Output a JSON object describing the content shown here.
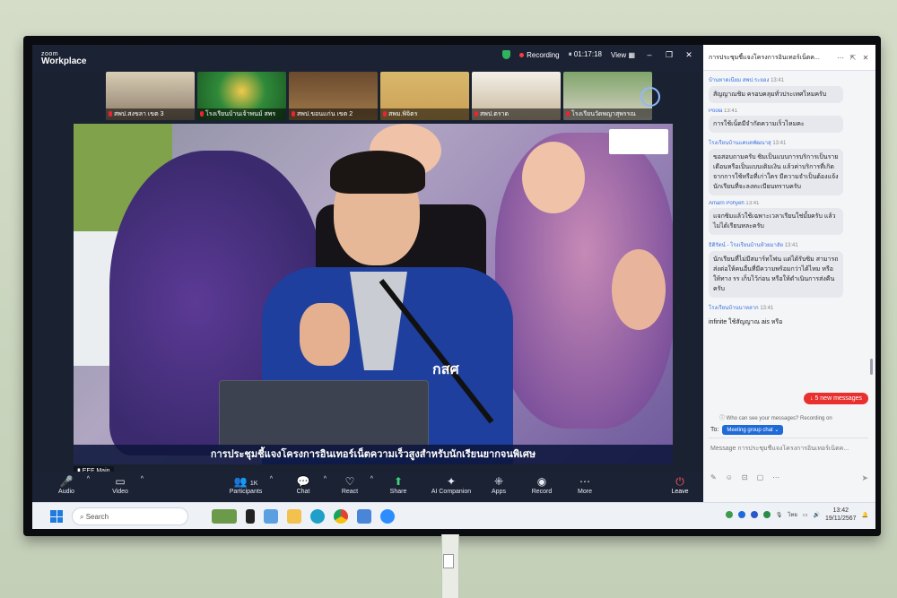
{
  "app": {
    "brand_top": "zoom",
    "brand_bottom": "Workplace"
  },
  "topbar": {
    "recording_label": "Recording",
    "timer": "01:17:18",
    "view_label": "View"
  },
  "thumbnails": [
    {
      "label": "สพป.สงขลา เขต 3"
    },
    {
      "label": "โรงเรียนบ้านเจ้าพนม์ สพร"
    },
    {
      "label": "สพป.ขอนแก่น เขต 2"
    },
    {
      "label": "สพม.พิจิตร"
    },
    {
      "label": "สพป.ตราด"
    },
    {
      "label": "โรงเรียนวัดพญาสุพรรณ"
    }
  ],
  "main_video": {
    "caption": "การประชุมชี้แจงโครงการอินเทอร์เน็ตความเร็วสูงสำหรับนักเรียนยากจนพิเศษ",
    "participant_name": "EEF Main",
    "jacket_logo": "กสศ"
  },
  "toolbar": {
    "audio": "Audio",
    "video": "Video",
    "participants": "Participants",
    "participants_count": "1K",
    "chat": "Chat",
    "react": "React",
    "share": "Share",
    "ai": "AI Companion",
    "apps": "Apps",
    "record": "Record",
    "more": "More",
    "leave": "Leave"
  },
  "chat": {
    "title": "การประชุมชี้แจงโครงการอินเทอร์เน็ตค...",
    "messages": [
      {
        "sender": "บ้านหาดเนียม สพป.ระยอง",
        "time": "13:41",
        "text": "สัญญาณชิม ครอบคลุมทั่วประเทศไหมครับ"
      },
      {
        "sender": "Poola",
        "time": "13:41",
        "text": "การใช้เน็ตมีจำกัดความเร็วไหมคะ"
      },
      {
        "sender": "โรงเรียนบ้านแคบดพัฒนาสุ",
        "time": "13:41",
        "text": "ขอสอบถามครับ ซิมเป็นแบบการบริการเป็นรายเดือนหรือเป็นแบบเติมเงิน แล้วค่าบริการที่เกิดจากการใช้หรือที่เก่าใคร มีความจำเป็นต้องแจ้งนักเรียนที่จะลงทะเบียนทราบครับ"
      },
      {
        "sender": "Amarn Pohyeh",
        "time": "13:41",
        "text": "แจกซิมแล้วใช้เฉพาะเวลาเรียนใช่มั้ยครับ แล้วไม่ได้เรียนหละครับ"
      },
      {
        "sender": "ธิติรัตน์ - โรงเรียนบ้านห้วยมาลัย",
        "time": "13:41",
        "text": "นักเรียนที่ไม่มีสมาร์ทโฟน แต่ได้รับซิม สามารถส่งต่อให้คนอื่นที่มีความพร้อมกว่าได้ไหม หรือให้ทาง รร เก็บไว้ก่อน หรือให้ดำเนินการส่งคืนครับ"
      },
      {
        "sender": "โรงเรียนบ้านนาหลาก",
        "time": "13:41",
        "text": "infinite ใช้สัญญาณ ais หรือ"
      }
    ],
    "new_messages": "5 new messages",
    "who_can_see": "Who can see your messages? Recording on",
    "to_label": "To:",
    "to_value": "Meeting group chat",
    "compose_placeholder": "Message การประชุมชี้แจงโครงการอินเทอร์เน็ตค..."
  },
  "taskbar": {
    "search_placeholder": "Search",
    "lang": "ไทย",
    "time": "13:42",
    "date": "19/11/2567"
  },
  "colors": {
    "zoom_bg": "#1b2233",
    "accent_blue": "#1f6ad9",
    "alert_red": "#e8312f"
  }
}
